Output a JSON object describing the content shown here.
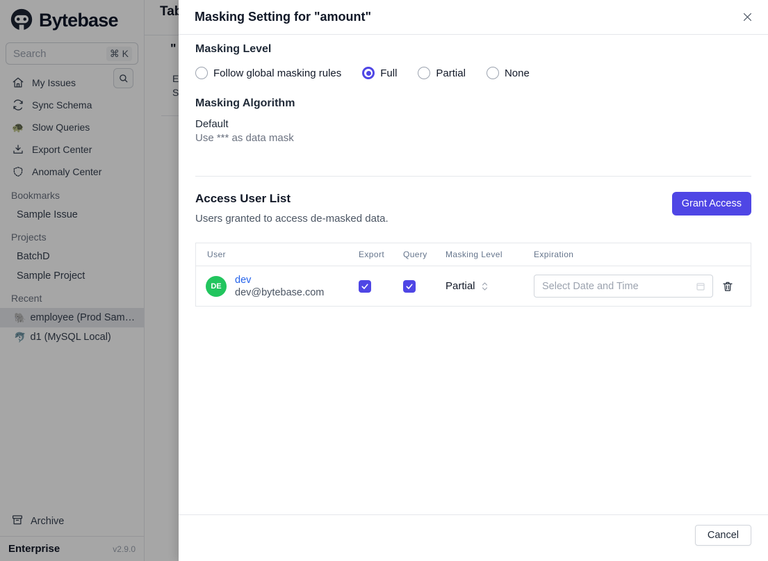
{
  "sidebar": {
    "brand": "Bytebase",
    "search_placeholder": "Search",
    "search_shortcut": "⌘ K",
    "nav_items": [
      {
        "label": "My Issues",
        "icon": "home-icon"
      },
      {
        "label": "Sync Schema",
        "icon": "sync-icon"
      },
      {
        "label": "Slow Queries",
        "icon": "turtle-icon"
      },
      {
        "label": "Export Center",
        "icon": "download-icon"
      },
      {
        "label": "Anomaly Center",
        "icon": "shield-icon"
      }
    ],
    "section_bookmarks": "Bookmarks",
    "item_sample_issue": "Sample Issue",
    "section_projects": "Projects",
    "item_batchd": "BatchD",
    "item_sample_project": "Sample Project",
    "section_recent": "Recent",
    "item_employee": "employee (Prod Sam…",
    "item_employee_icon": "🐘",
    "item_d1": "d1 (MySQL Local)",
    "item_d1_icon": "🐬",
    "archive_label": "Archive",
    "plan_label": "Enterprise",
    "version": "v2.9.0"
  },
  "page_behind": {
    "heading_fragment": "Tab",
    "quote_fragment": "\"",
    "fragment_e": "E",
    "fragment_s": "S"
  },
  "modal": {
    "title": "Masking Setting for \"amount\"",
    "masking_level": {
      "heading": "Masking Level",
      "options": [
        {
          "label": "Follow global masking rules",
          "selected": false
        },
        {
          "label": "Full",
          "selected": true
        },
        {
          "label": "Partial",
          "selected": false
        },
        {
          "label": "None",
          "selected": false
        }
      ]
    },
    "masking_algorithm": {
      "heading": "Masking Algorithm",
      "name": "Default",
      "description": "Use *** as data mask"
    },
    "access": {
      "heading": "Access User List",
      "subtitle": "Users granted to access de-masked data.",
      "grant_button": "Grant Access"
    },
    "table": {
      "headers": [
        "User",
        "Export",
        "Query",
        "Masking Level",
        "Expiration"
      ],
      "rows": [
        {
          "avatar": "DE",
          "name": "dev",
          "email": "dev@bytebase.com",
          "export_checked": true,
          "query_checked": true,
          "masking_level": "Partial",
          "expiration_placeholder": "Select Date and Time"
        }
      ]
    },
    "cancel_button": "Cancel"
  },
  "colors": {
    "accent": "#4f46e5",
    "avatar_green": "#22c55e",
    "link_blue": "#2563eb",
    "overlay": "rgba(0,0,0,0.35)"
  }
}
